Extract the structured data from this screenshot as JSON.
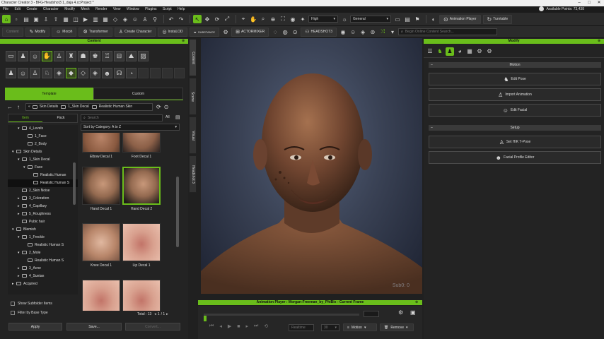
{
  "window": {
    "title": "Character Creator 3 - BFG-Headshot3 1_daja 4.ccProject *",
    "controls": [
      "–",
      "□",
      "✕"
    ]
  },
  "menu": {
    "items": [
      "File",
      "Edit",
      "Create",
      "Character",
      "Modify",
      "Mesh",
      "Render",
      "View",
      "Window",
      "Plugins",
      "Script",
      "Help"
    ],
    "points": "Available Points: 73,438"
  },
  "toolbar1": {
    "quality": "High",
    "shading": "General",
    "animation_player": "Animation Player",
    "turntable": "Turntable"
  },
  "toolbar2": {
    "content": "Content",
    "modify": "Modify",
    "morph": "Morph",
    "transformer": "Transformer",
    "create_character": "Create Character",
    "instalod": "InstaLOD",
    "substance": "SUBSTANCE",
    "actormixer": "ACTORMIXER",
    "headshot": "HEADSHOT3",
    "search_placeholder": "Begin Online Content Search..."
  },
  "content": {
    "title": "Content",
    "tab_template": "Template",
    "tab_custom": "Custom",
    "breadcrumb": [
      "Skin Details",
      "1_Skin Decal",
      "Realistic Human Skin"
    ],
    "search_placeholder": "Search",
    "filter_all": "All",
    "subtab_item": "Item",
    "subtab_pack": "Pack",
    "sort": "Sort by Category: A to Z",
    "tree": [
      {
        "label": "4_Levels",
        "indent": 2,
        "arrow": "▾"
      },
      {
        "label": "1_Face",
        "indent": 3,
        "arrow": ""
      },
      {
        "label": "2_Body",
        "indent": 3,
        "arrow": ""
      },
      {
        "label": "Skin Details",
        "indent": 1,
        "arrow": "▾"
      },
      {
        "label": "1_Skin Decal",
        "indent": 2,
        "arrow": "▾"
      },
      {
        "label": "Face",
        "indent": 3,
        "arrow": "▾"
      },
      {
        "label": "Realistic Human",
        "indent": 4,
        "arrow": ""
      },
      {
        "label": "Realistic Human S",
        "indent": 4,
        "arrow": "",
        "sel": true
      },
      {
        "label": "2_Skin Noise",
        "indent": 2,
        "arrow": ""
      },
      {
        "label": "3_Coloration",
        "indent": 2,
        "arrow": "▸"
      },
      {
        "label": "4_Capillary",
        "indent": 2,
        "arrow": "▸"
      },
      {
        "label": "5_Roughness",
        "indent": 2,
        "arrow": "▸"
      },
      {
        "label": "Pubic hair",
        "indent": 2,
        "arrow": ""
      },
      {
        "label": "Blemish",
        "indent": 1,
        "arrow": "▾"
      },
      {
        "label": "1_Freckle",
        "indent": 2,
        "arrow": "▾"
      },
      {
        "label": "Realistic Human S",
        "indent": 3,
        "arrow": ""
      },
      {
        "label": "2_Mole",
        "indent": 2,
        "arrow": "▾"
      },
      {
        "label": "Realistic Human S",
        "indent": 3,
        "arrow": ""
      },
      {
        "label": "3_Acne",
        "indent": 2,
        "arrow": "▸"
      },
      {
        "label": "4_Suntan",
        "indent": 2,
        "arrow": "▸"
      },
      {
        "label": "Acquired",
        "indent": 1,
        "arrow": "▸"
      }
    ],
    "thumbs": [
      {
        "label": "Elbow Decal 1",
        "kind": "elbow"
      },
      {
        "label": "Foot Decal 1",
        "kind": "foot"
      },
      {
        "label": "Hand Decal 1",
        "kind": "hand"
      },
      {
        "label": "Hand Decal 2",
        "kind": "hand",
        "sel": true
      },
      {
        "label": "Knee Decal 1",
        "kind": "knee"
      },
      {
        "label": "Lip Decal 1",
        "kind": "lip"
      },
      {
        "label": "",
        "kind": "lip"
      },
      {
        "label": "",
        "kind": "lip"
      }
    ],
    "show_subfolder": "Show Subfolder Items",
    "filter_base": "Filter by Base Type",
    "total": "Total : 13",
    "page": "1",
    "pages": "/ 1",
    "apply": "Apply",
    "save": "Save...",
    "convert": "Convert..."
  },
  "side_tabs": [
    "Content",
    "Scene",
    "Visual",
    "Headshot 3"
  ],
  "viewport": {
    "watermark": "Sub0: 0"
  },
  "anim": {
    "title": "Animation Player : Morgan-Freeman_by_PhiBix - Current Frame",
    "realtime": "Realtime",
    "fps": "30",
    "motion": "Motion",
    "remove": "Remove"
  },
  "modify": {
    "title": "Modify",
    "motion_section": "Motion",
    "setup_section": "Setup",
    "buttons": [
      "Edit Pose",
      "Import Animation",
      "Edit Facial",
      "Set HIK T-Pose",
      "Facial Profile Editor"
    ]
  },
  "colors": {
    "accent": "#6abd1b"
  }
}
